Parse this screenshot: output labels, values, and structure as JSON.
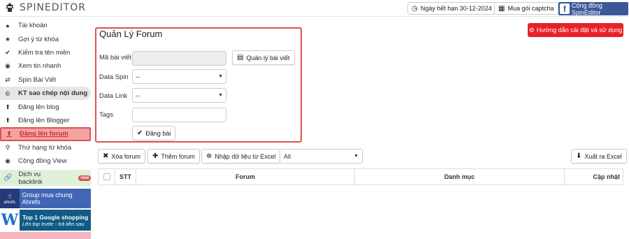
{
  "app": {
    "title": "SPINEDITOR"
  },
  "topbar": {
    "expiry_label": "Ngày hết hạn 30-12-2024",
    "captcha_label": "Mua gói captcha",
    "community_label": "Cộng đồng SpinEditor"
  },
  "sidebar": {
    "items": [
      {
        "label": "Tài khoản",
        "icon": "user-icon"
      },
      {
        "label": "Gợi ý từ khóa",
        "icon": "star-icon"
      },
      {
        "label": "Kiểm tra tên miền",
        "icon": "check-icon"
      },
      {
        "label": "Xem tin nhanh",
        "icon": "eye-icon"
      },
      {
        "label": "Spin Bài Viết",
        "icon": "shuffle-icon"
      },
      {
        "label": "KT sao chép nội dung",
        "icon": "copyright-icon"
      },
      {
        "label": "Đăng lên blog",
        "icon": "upload-icon"
      },
      {
        "label": "Đăng lên Blogger",
        "icon": "upload-icon"
      },
      {
        "label": "Đăng lên forum",
        "icon": "upload-icon"
      },
      {
        "label": "Thứ hạng từ khóa",
        "icon": "search-icon"
      },
      {
        "label": "Cộng đồng View",
        "icon": "eye-icon"
      }
    ],
    "backlink_label": "Dịch vụ backlink",
    "backlink_badge": "new",
    "ahrefs_label": "Group mua chung Ahrefs",
    "ahrefs_logo_text": "ahrefs",
    "gshop_title": "Top 1 Google shopping",
    "gshop_sub": "Lên top trước - trả tiền sau"
  },
  "form": {
    "title": "Quản Lý Forum",
    "post_id_label": "Mã bài viết",
    "manage_posts_label": "Quản lý bài viết",
    "data_spin_label": "Data Spin",
    "data_spin_value": "--",
    "data_link_label": "Data Link",
    "data_link_value": "--",
    "tags_label": "Tags",
    "submit_label": "Đăng bài"
  },
  "help_button": "Hướng dẫn cài đặt và sử dụng",
  "toolbar": {
    "delete_label": "Xóa forum",
    "add_label": "Thêm forum",
    "import_label": "Nhập dữ liệu từ Excel",
    "filter_value": "All",
    "export_label": "Xuất ra Excel"
  },
  "table": {
    "columns": [
      "STT",
      "Forum",
      "Danh mục",
      "Cập nhật"
    ]
  },
  "colors": {
    "accent_red": "#d9534f",
    "help_red": "#e8202a",
    "facebook_blue": "#3b5998",
    "backlink_green": "#dff0d8"
  }
}
